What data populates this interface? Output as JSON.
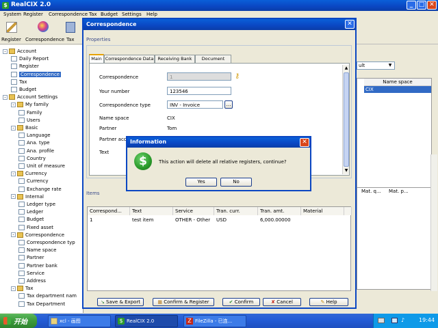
{
  "app": {
    "title": "RealCIX 2.0",
    "menu": [
      "System",
      "Register",
      "Correspondence",
      "Tax",
      "Budget",
      "Settings",
      "Help"
    ],
    "toolbar": [
      {
        "label": "Register",
        "icon": "pencil-icon"
      },
      {
        "label": "Correspondence",
        "icon": "globe-icon"
      },
      {
        "label": "Tax",
        "icon": "tax-icon"
      }
    ]
  },
  "tree": [
    {
      "label": "Account",
      "level": 0,
      "type": "root",
      "expander": "-"
    },
    {
      "label": "Daily Report",
      "level": 1,
      "type": "doc"
    },
    {
      "label": "Register",
      "level": 1,
      "type": "doc"
    },
    {
      "label": "Correspondence",
      "level": 1,
      "type": "doc",
      "selected": true
    },
    {
      "label": "Tax",
      "level": 1,
      "type": "doc"
    },
    {
      "label": "Budget",
      "level": 1,
      "type": "doc"
    },
    {
      "label": "Account Settings",
      "level": 0,
      "type": "root",
      "expander": "-"
    },
    {
      "label": "My family",
      "level": 1,
      "type": "folder",
      "expander": "-"
    },
    {
      "label": "Family",
      "level": 2,
      "type": "doc"
    },
    {
      "label": "Users",
      "level": 2,
      "type": "doc"
    },
    {
      "label": "Basic",
      "level": 1,
      "type": "folder",
      "expander": "-"
    },
    {
      "label": "Language",
      "level": 2,
      "type": "doc"
    },
    {
      "label": "Ana. type",
      "level": 2,
      "type": "doc"
    },
    {
      "label": "Ana. profile",
      "level": 2,
      "type": "doc"
    },
    {
      "label": "Country",
      "level": 2,
      "type": "doc"
    },
    {
      "label": "Unit of measure",
      "level": 2,
      "type": "doc"
    },
    {
      "label": "Currency",
      "level": 1,
      "type": "folder",
      "expander": "-"
    },
    {
      "label": "Currency",
      "level": 2,
      "type": "doc"
    },
    {
      "label": "Exchange rate",
      "level": 2,
      "type": "doc"
    },
    {
      "label": "Internal",
      "level": 1,
      "type": "folder",
      "expander": "-"
    },
    {
      "label": "Ledger type",
      "level": 2,
      "type": "doc"
    },
    {
      "label": "Ledger",
      "level": 2,
      "type": "doc"
    },
    {
      "label": "Budget",
      "level": 2,
      "type": "doc"
    },
    {
      "label": "Fixed asset",
      "level": 2,
      "type": "doc"
    },
    {
      "label": "Correspondence",
      "level": 1,
      "type": "folder",
      "expander": "-"
    },
    {
      "label": "Correspondence typ",
      "level": 2,
      "type": "doc"
    },
    {
      "label": "Name space",
      "level": 2,
      "type": "doc"
    },
    {
      "label": "Partner",
      "level": 2,
      "type": "doc"
    },
    {
      "label": "Partner bank",
      "level": 2,
      "type": "doc"
    },
    {
      "label": "Service",
      "level": 2,
      "type": "doc"
    },
    {
      "label": "Address",
      "level": 2,
      "type": "doc"
    },
    {
      "label": "Tax",
      "level": 1,
      "type": "folder",
      "expander": "-"
    },
    {
      "label": "Tax department nam",
      "level": 2,
      "type": "doc"
    },
    {
      "label": "Tax Department",
      "level": 2,
      "type": "doc"
    }
  ],
  "background": {
    "dropdown_value": "ult",
    "name_space_header": "Name space",
    "name_space_value": "CIX",
    "mat_headers": [
      "Mat. q...",
      "Mat. p..."
    ]
  },
  "dialog": {
    "title": "Correspondence",
    "properties_label": "Properties",
    "tabs": [
      "Main",
      "Correspondence Data",
      "Receiving Bank",
      "Document Data"
    ],
    "fields": {
      "correspondence_label": "Correspondence",
      "correspondence_value": "1",
      "your_number_label": "Your number",
      "your_number_value": "123546",
      "type_label": "Correspondence type",
      "type_value": "INV - Invoice",
      "namespace_label": "Name space",
      "namespace_value": "CIX",
      "partner_label": "Partner",
      "partner_value": "Tom",
      "partner_account_label": "Partner acco",
      "text_label": "Text"
    },
    "items_label": "Items",
    "items_headers": [
      "Correspond...",
      "Text",
      "Service",
      "Tran. curr.",
      "Tran. amt.",
      "Material"
    ],
    "items_rows": [
      [
        "1",
        "test item",
        "OTHER - Other",
        "USD",
        "6,000.00000",
        ""
      ]
    ],
    "buttons": {
      "save": "Save & Export",
      "confirm_register": "Confirm & Register",
      "confirm": "Confirm",
      "cancel": "Cancel",
      "help": "Help"
    }
  },
  "info": {
    "title": "Information",
    "message": "This action will delete all relative registers, continue?",
    "yes": "Yes",
    "no": "No",
    "icon_symbol": "$"
  },
  "taskbar": {
    "start": "开始",
    "items": [
      "xcl - 画图",
      "RealCIX 2.0",
      "FileZilla - 已连..."
    ],
    "clock": "19:44"
  },
  "colors": {
    "accent_blue": "#0a46c2",
    "selection": "#316ac5",
    "info_icon_green": "#2a9a2a",
    "close_red": "#d9461b"
  }
}
